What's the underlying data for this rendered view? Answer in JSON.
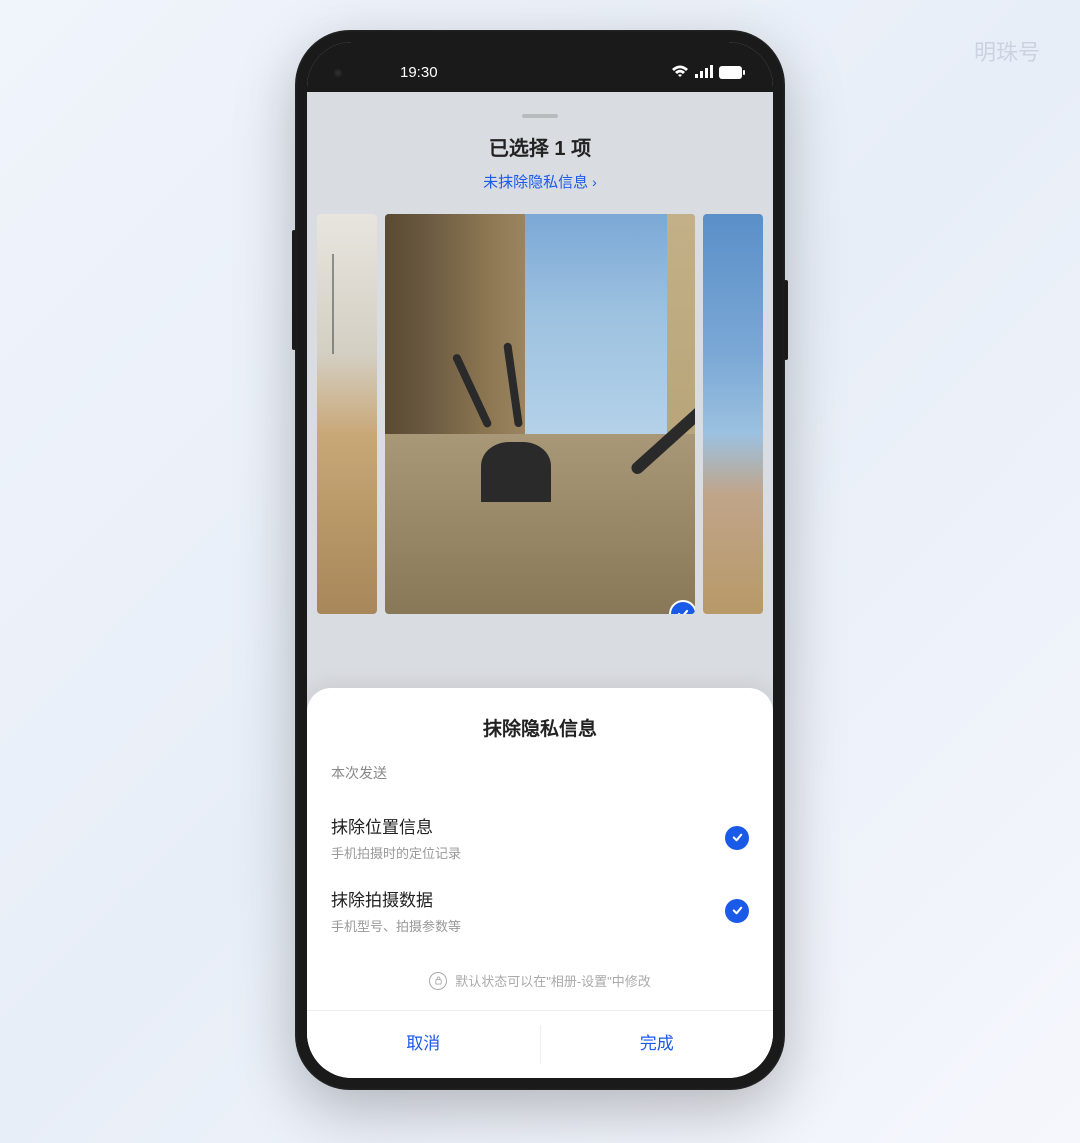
{
  "watermark": "明珠号",
  "status_bar": {
    "time": "19:30"
  },
  "header": {
    "title": "已选择 1 项",
    "subtitle": "未抹除隐私信息",
    "chevron": "›"
  },
  "sheet": {
    "title": "抹除隐私信息",
    "subtitle": "本次发送",
    "options": [
      {
        "title": "抹除位置信息",
        "desc": "手机拍摄时的定位记录",
        "checked": true
      },
      {
        "title": "抹除拍摄数据",
        "desc": "手机型号、拍摄参数等",
        "checked": true
      }
    ],
    "footer_hint": "默认状态可以在\"相册-设置\"中修改",
    "cancel_label": "取消",
    "confirm_label": "完成"
  },
  "colors": {
    "accent": "#1a5ae8"
  }
}
